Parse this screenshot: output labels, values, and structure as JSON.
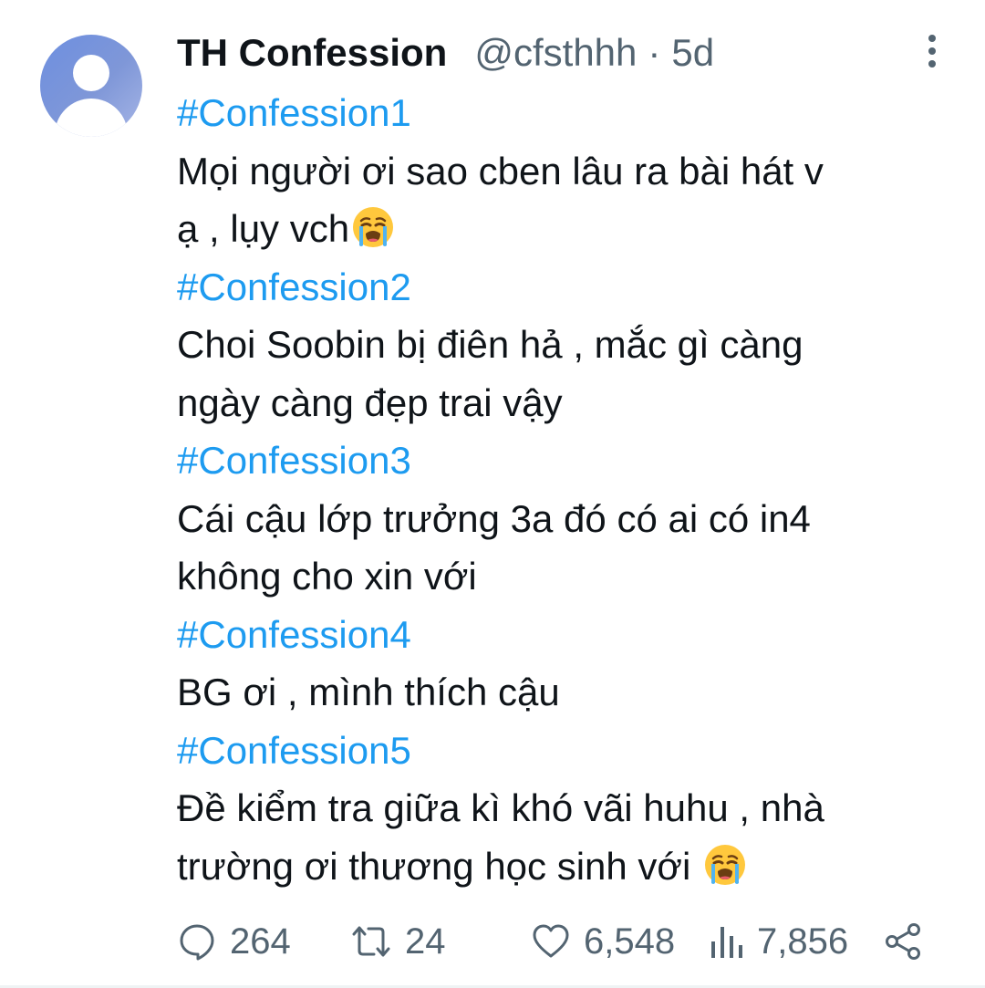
{
  "author": {
    "display_name": "TH Confession",
    "handle": "@cfsthhh",
    "separator": "·",
    "time": "5d"
  },
  "tweet": {
    "lines": [
      {
        "text": "#Confession1",
        "hashtag": true
      },
      {
        "text": "Mọi người ơi sao cben lâu ra bài hát v",
        "hashtag": false
      },
      {
        "text": "ạ , lụy vch",
        "hashtag": false,
        "emoji": "crying-face"
      },
      {
        "text": "#Confession2",
        "hashtag": true
      },
      {
        "text": "Choi Soobin bị điên hả , mắc gì càng",
        "hashtag": false
      },
      {
        "text": "ngày càng đẹp trai vậy",
        "hashtag": false
      },
      {
        "text": "#Confession3",
        "hashtag": true
      },
      {
        "text": "Cái cậu lớp trưởng 3a đó có ai có in4",
        "hashtag": false
      },
      {
        "text": "không cho xin với",
        "hashtag": false
      },
      {
        "text": "#Confession4",
        "hashtag": true
      },
      {
        "text": "BG ơi , mình thích cậu",
        "hashtag": false
      },
      {
        "text": "#Confession5",
        "hashtag": true
      },
      {
        "text": "Đề kiểm tra giữa kì khó vãi huhu , nhà",
        "hashtag": false
      },
      {
        "text": "trường ơi thương học sinh với ",
        "hashtag": false,
        "emoji": "crying-face"
      }
    ]
  },
  "actions": {
    "replies": "264",
    "retweets": "24",
    "likes": "6,548",
    "views": "7,856"
  },
  "colors": {
    "text": "#0f1419",
    "muted": "#536471",
    "hashtag": "#1d9bf0",
    "avatar": "#7f97d8"
  }
}
